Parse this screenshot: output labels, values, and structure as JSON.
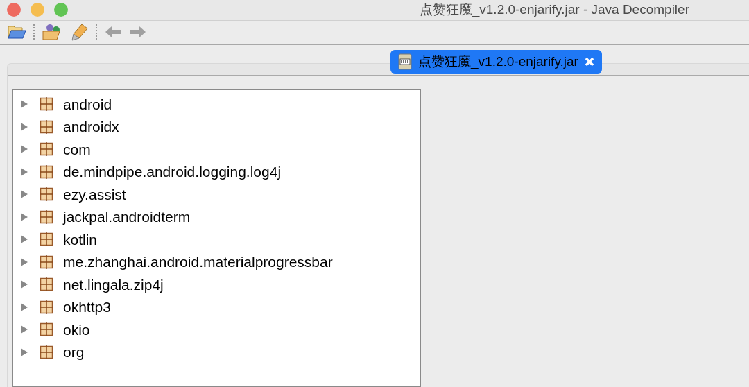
{
  "window": {
    "title": "点赞狂魔_v1.2.0-enjarify.jar - Java Decompiler"
  },
  "tabs": [
    {
      "label": "点赞狂魔_v1.2.0-enjarify.jar",
      "selected": true
    }
  ],
  "tree": [
    {
      "label": "android",
      "expanded": false
    },
    {
      "label": "androidx",
      "expanded": false
    },
    {
      "label": "com",
      "expanded": false
    },
    {
      "label": "de.mindpipe.android.logging.log4j",
      "expanded": false
    },
    {
      "label": "ezy.assist",
      "expanded": false
    },
    {
      "label": "jackpal.androidterm",
      "expanded": false
    },
    {
      "label": "kotlin",
      "expanded": false
    },
    {
      "label": "me.zhanghai.android.materialprogressbar",
      "expanded": false
    },
    {
      "label": "net.lingala.zip4j",
      "expanded": false
    },
    {
      "label": "okhttp3",
      "expanded": false
    },
    {
      "label": "okio",
      "expanded": false
    },
    {
      "label": "org",
      "expanded": false
    }
  ]
}
